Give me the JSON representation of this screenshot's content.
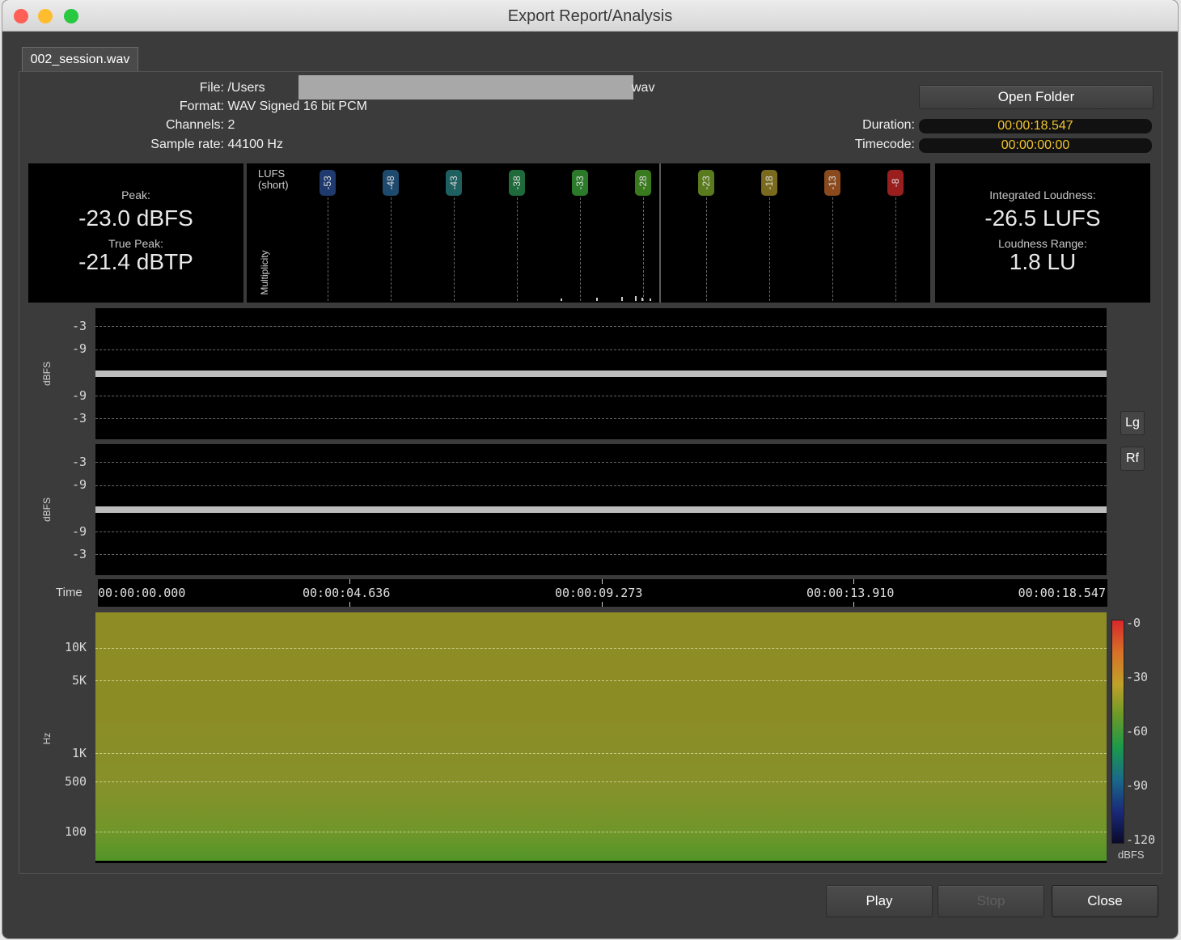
{
  "window": {
    "title": "Export Report/Analysis"
  },
  "tab": {
    "label": "002_session.wav"
  },
  "file_info": {
    "file_label": "File:",
    "file_value_prefix": "/Users",
    "file_value_suffix": "wav",
    "format_label": "Format:",
    "format_value": "WAV Signed 16 bit PCM",
    "channels_label": "Channels:",
    "channels_value": "2",
    "samplerate_label": "Sample rate:",
    "samplerate_value": "44100 Hz"
  },
  "buttons": {
    "open_folder": "Open Folder",
    "play": "Play",
    "stop": "Stop",
    "close": "Close",
    "lg": "Lg",
    "rf": "Rf"
  },
  "duration": {
    "label": "Duration:",
    "value": "00:00:18.547"
  },
  "timecode": {
    "label": "Timecode:",
    "value": "00:00:00:00"
  },
  "peak": {
    "peak_label": "Peak:",
    "peak_value": "-23.0 dBFS",
    "true_peak_label": "True Peak:",
    "true_peak_value": "-21.4 dBTP"
  },
  "loudness": {
    "integrated_label": "Integrated Loudness:",
    "integrated_value": "-26.5 LUFS",
    "range_label": "Loudness Range:",
    "range_value": "1.8 LU"
  },
  "histogram": {
    "title_line1": "LUFS",
    "title_line2": "(short)",
    "ylabel": "Multiplicity",
    "markers": [
      {
        "label": "-53",
        "color": "#1e3a6e"
      },
      {
        "label": "-48",
        "color": "#1e4a6e"
      },
      {
        "label": "-43",
        "color": "#1e6060"
      },
      {
        "label": "-38",
        "color": "#1e6a3a"
      },
      {
        "label": "-33",
        "color": "#2a7a2a"
      },
      {
        "label": "-28",
        "color": "#3a7a1e"
      },
      {
        "label": "-23",
        "color": "#5a7a1e"
      },
      {
        "label": "-18",
        "color": "#7a6a1e"
      },
      {
        "label": "-13",
        "color": "#8a4a1e"
      },
      {
        "label": "-8",
        "color": "#9a1e1e"
      }
    ]
  },
  "waveform": {
    "ylabel": "dBFS",
    "ticks": [
      "-3",
      "-9",
      "-9",
      "-3"
    ]
  },
  "timeline": {
    "label": "Time",
    "ticks": [
      "00:00:00.000",
      "00:00:04.636",
      "00:00:09.273",
      "00:00:13.910",
      "00:00:18.547"
    ]
  },
  "spectrogram": {
    "ylabel": "Hz",
    "ticks": [
      "10K",
      "5K",
      "1K",
      "500",
      "100"
    ],
    "colorbar_ticks": [
      "-0",
      "-30",
      "-60",
      "-90",
      "-120"
    ],
    "colorbar_unit": "dBFS"
  }
}
